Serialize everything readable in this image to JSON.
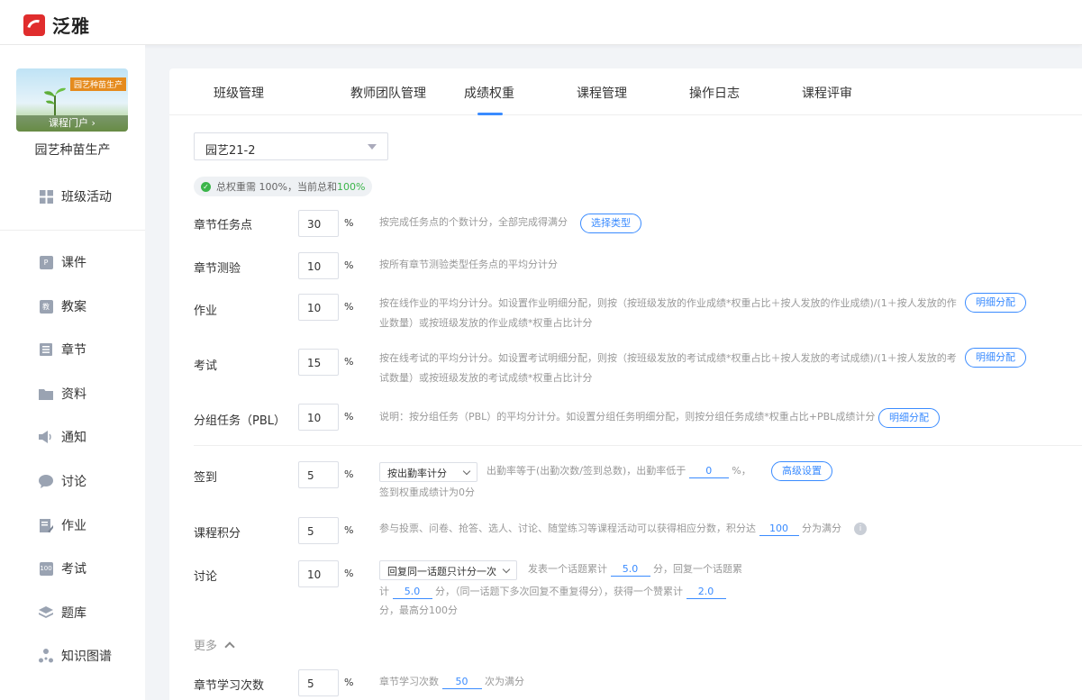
{
  "app": {
    "name": "泛雅"
  },
  "sidebar": {
    "cover_tag": "园艺种苗生产",
    "cover_button": "课程门户",
    "course_name": "园艺种苗生产",
    "items": [
      {
        "label": "班级活动",
        "icon": "grid-icon"
      },
      {
        "label": "课件",
        "icon": "ppt-icon"
      },
      {
        "label": "教案",
        "icon": "lesson-plan-icon"
      },
      {
        "label": "章节",
        "icon": "chapter-list-icon"
      },
      {
        "label": "资料",
        "icon": "folder-icon"
      },
      {
        "label": "通知",
        "icon": "megaphone-icon"
      },
      {
        "label": "讨论",
        "icon": "chat-bubble-icon"
      },
      {
        "label": "作业",
        "icon": "homework-icon"
      },
      {
        "label": "考试",
        "icon": "exam-icon"
      },
      {
        "label": "题库",
        "icon": "layers-icon"
      },
      {
        "label": "知识图谱",
        "icon": "knowledge-graph-icon"
      }
    ]
  },
  "tabs": [
    "班级管理",
    "教师团队管理",
    "成绩权重",
    "课程管理",
    "操作日志",
    "课程评审"
  ],
  "active_tab": "成绩权重",
  "class_select": "园艺21-2",
  "total_badge": {
    "prefix": "总权重需 100%，当前总和 ",
    "value": "100%"
  },
  "percent_sign": "%",
  "weights": [
    {
      "label": "章节任务点",
      "value": "30",
      "desc": "按完成任务点的个数计分，全部完成得满分",
      "button": "选择类型"
    },
    {
      "label": "章节测验",
      "value": "10",
      "desc": "按所有章节测验类型任务点的平均分计分"
    },
    {
      "label": "作业",
      "value": "10",
      "desc1": "按在线作业的平均分计分。如设置作业明细分配，则按（按班级发放的作业成绩*权重占比＋按人发放的作业成绩)/(1＋按人发放的作",
      "desc2": "业数量）或按班级发放的作业成绩*权重占比计分",
      "button": "明细分配"
    },
    {
      "label": "考试",
      "value": "15",
      "desc1": "按在线考试的平均分计分。如设置考试明细分配，则按（按班级发放的考试成绩*权重占比＋按人发放的考试成绩)/(1＋按人发放的考",
      "desc2": "试数量）或按班级发放的考试成绩*权重占比计分",
      "button": "明细分配"
    },
    {
      "label": "分组任务（PBL）",
      "value": "10",
      "desc": "说明：按分组任务（PBL）的平均分计分。如设置分组任务明细分配，则按分组任务成绩*权重占比+PBL成绩计分",
      "button": "明细分配"
    }
  ],
  "checkin": {
    "label": "签到",
    "value": "5",
    "mode": "按出勤率计分",
    "text1": "出勤率等于(出勤次数/签到总数)，出勤率低于",
    "threshold": "0",
    "text2": "%，",
    "button": "高级设置",
    "text3": "签到权重成绩计为0分"
  },
  "points": {
    "label": "课程积分",
    "value": "5",
    "text1": "参与投票、问卷、抢答、选人、讨论、随堂练习等课程活动可以获得相应分数，积分达",
    "full": "100",
    "text2": "分为满分"
  },
  "discussion": {
    "label": "讨论",
    "value": "10",
    "mode": "回复同一话题只计分一次",
    "t1": "发表一个话题累计",
    "v1": "5.0",
    "t2": "分，回复一个话题累",
    "t3": "计",
    "v2": "5.0",
    "t4": "分，（同一话题下多次回复不重复得分），获得一个赞累计",
    "v3": "2.0",
    "t5": "分，最高分100分"
  },
  "more_label": "更多",
  "chapter_study": {
    "label": "章节学习次数",
    "value": "5",
    "t1": "章节学习次数",
    "v": "50",
    "t2": "次为满分"
  },
  "colors": {
    "accent": "#3a8bff",
    "success": "#3bb54a",
    "brand": "#e02d2d"
  }
}
